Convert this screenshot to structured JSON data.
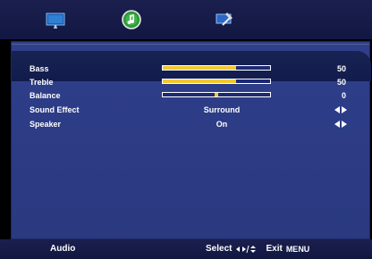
{
  "tabs": [
    {
      "name": "picture",
      "icon": "picture-monitor-icon"
    },
    {
      "name": "audio",
      "icon": "audio-note-icon",
      "active": true
    },
    {
      "name": "setup",
      "icon": "setup-tools-icon"
    }
  ],
  "menu": {
    "items": [
      {
        "label": "Bass",
        "type": "slider",
        "value": "50",
        "level": 0.68
      },
      {
        "label": "Treble",
        "type": "slider",
        "value": "50",
        "level": 0.68
      },
      {
        "label": "Balance",
        "type": "balance",
        "value": "0",
        "level": 0.5
      },
      {
        "label": "Sound Effect",
        "type": "option",
        "value": "Surround"
      },
      {
        "label": "Speaker",
        "type": "option",
        "value": "On"
      }
    ]
  },
  "bottom": {
    "section": "Audio",
    "select_label": "Select",
    "exit_label": "Exit",
    "menu_label": "MENU"
  },
  "colors": {
    "slider_fill": "#f2c832",
    "panel": "#2d3c86",
    "bar_bg": "#1d2a73"
  }
}
